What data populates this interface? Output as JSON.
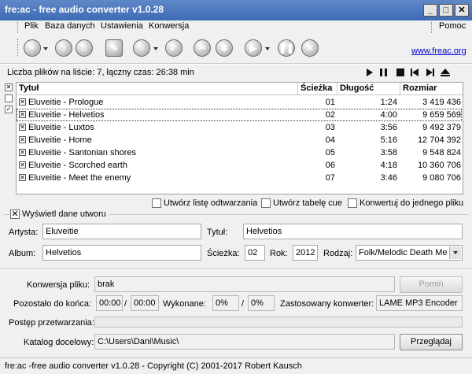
{
  "window": {
    "title": "fre:ac - free audio converter v1.0.28",
    "buttons": [
      "_",
      "□",
      "✕"
    ]
  },
  "menu": {
    "items": [
      "Plik",
      "Baza danych",
      "Ustawienia",
      "Konwersja"
    ],
    "help": "Pomoc"
  },
  "toolbar": {
    "link": "www.freac.org",
    "icons": [
      "add-files-icon",
      "cddb-query-icon",
      "cddb-submit-icon",
      "clear-list-icon",
      "search-icon",
      "cddb-icon",
      "settings-icon",
      "config-gear-icon",
      "play-icon",
      "pause-icon",
      "stop-icon"
    ]
  },
  "list": {
    "summary": "Liczba plików na liście: 7, łączny czas: 26:38 min",
    "columns": {
      "title": "Tytuł",
      "track": "Ścieżka",
      "length": "Długość",
      "size": "Rozmiar"
    },
    "rows": [
      {
        "title": "Eluveitie - Prologue",
        "track": "01",
        "length": "1:24",
        "size": "3 419 436"
      },
      {
        "title": "Eluveitie - Helvetios",
        "track": "02",
        "length": "4:00",
        "size": "9 659 569"
      },
      {
        "title": "Eluveitie - Luxtos",
        "track": "03",
        "length": "3:56",
        "size": "9 492 379"
      },
      {
        "title": "Eluveitie - Home",
        "track": "04",
        "length": "5:16",
        "size": "12 704 392"
      },
      {
        "title": "Eluveitie - Santonian shores",
        "track": "05",
        "length": "3:58",
        "size": "9 548 824"
      },
      {
        "title": "Eluveitie - Scorched earth",
        "track": "06",
        "length": "4:18",
        "size": "10 360 706"
      },
      {
        "title": "Eluveitie - Meet the enemy",
        "track": "07",
        "length": "3:46",
        "size": "9 080 706"
      }
    ],
    "check_mark": "✕"
  },
  "options": {
    "playlist": "Utwórz listę odtwarzania",
    "cue": "Utwórz tabelę cue",
    "single": "Konwertuj do jednego pliku"
  },
  "track_info": {
    "section": "Wyświetl dane utworu",
    "artist_label": "Artysta:",
    "artist": "Eluveitie",
    "title_label": "Tytuł:",
    "title": "Helvetios",
    "album_label": "Album:",
    "album": "Helvetios",
    "track_label": "Ścieżka:",
    "track": "02",
    "year_label": "Rok:",
    "year": "2012",
    "genre_label": "Rodzaj:",
    "genre": "Folk/Melodic Death Me"
  },
  "progress": {
    "file_label": "Konwersja pliku:",
    "file_value": "brak",
    "skip_button": "Pomiń",
    "remaining_label": "Pozostało do końca:",
    "remaining": "00:00",
    "total": "00:00",
    "done_label": "Wykonane:",
    "done_file": "0%",
    "done_total": "0%",
    "encoder_label": "Zastosowany konwerter:",
    "encoder": "LAME MP3 Encoder",
    "processing_label": "Postęp przetwarzania:",
    "processing_fraction": 0,
    "output_label": "Katalog docelowy:",
    "output_dir": "C:\\Users\\Dani\\Music\\",
    "browse_button": "Przeglądaj",
    "slash": "/"
  },
  "status": "fre:ac -free audio converter v1.0.28 - Copyright (C) 2001-2017 Robert Kausch"
}
